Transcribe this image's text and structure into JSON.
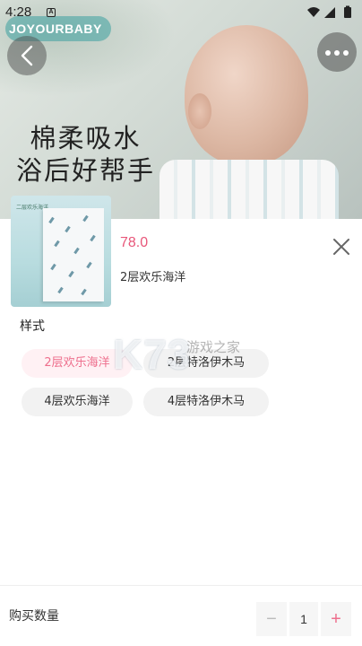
{
  "status_bar": {
    "time": "4:28",
    "notification_icon_letter": "A",
    "icons": [
      "wifi-icon",
      "signal-icon",
      "battery-icon"
    ]
  },
  "banner": {
    "brand": "JOYOURBABY",
    "headline_line1": "棉柔吸水",
    "headline_line2": "浴后好帮手"
  },
  "product": {
    "price": "78.0",
    "selected_spec": "2层欢乐海洋",
    "thumbnail_caption": "二层欢乐海洋"
  },
  "spec": {
    "title": "样式",
    "options": [
      {
        "label": "2层欢乐海洋",
        "selected": true
      },
      {
        "label": "2层特洛伊木马",
        "selected": false
      },
      {
        "label": "4层欢乐海洋",
        "selected": false
      },
      {
        "label": "4层特洛伊木马",
        "selected": false
      }
    ]
  },
  "watermark": {
    "logo": "K73",
    "text": "游戏之家"
  },
  "quantity": {
    "label": "购买数量",
    "minus": "−",
    "value": "1",
    "plus": "+"
  },
  "colors": {
    "accent": "#ee6f8d",
    "price": "#e8577a",
    "chip_bg": "#f2f2f2",
    "chip_active_bg": "#fff1f4"
  }
}
